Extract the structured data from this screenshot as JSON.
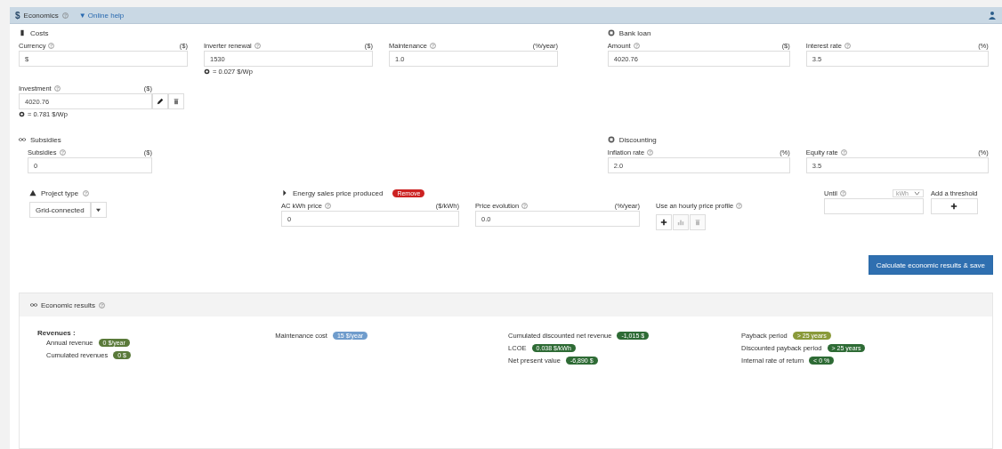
{
  "header": {
    "icon": "$",
    "title": "Economics",
    "help_link": "▼ Online help"
  },
  "costs": {
    "title": "Costs",
    "fields": [
      {
        "label": "Currency",
        "unit": "($)",
        "value": "$"
      },
      {
        "label": "Inverter renewal",
        "unit": "($)",
        "value": "1530",
        "note": "= 0.027 $/Wp"
      },
      {
        "label": "Maintenance",
        "unit": "(%/year)",
        "value": "1.0"
      }
    ],
    "investment": {
      "label": "Investment",
      "unit": "($)",
      "value": "4020.76",
      "note": "= 0.781 $/Wp"
    }
  },
  "bank_loan": {
    "title": "Bank loan",
    "fields": [
      {
        "label": "Amount",
        "unit": "($)",
        "value": "4020.76"
      },
      {
        "label": "Interest rate",
        "unit": "(%)",
        "value": "3.5"
      }
    ]
  },
  "subsidies": {
    "title": "Subsidies",
    "field": {
      "label": "Subsidies",
      "unit": "($)",
      "value": "0"
    }
  },
  "discounting": {
    "title": "Discounting",
    "fields": [
      {
        "label": "Inflation rate",
        "unit": "(%)",
        "value": "2.0"
      },
      {
        "label": "Equity rate",
        "unit": "(%)",
        "value": "3.5"
      }
    ]
  },
  "project_type": {
    "title": "Project type",
    "value": "Grid-connected"
  },
  "energy_sales": {
    "title": "Energy sales price produced",
    "badge": "Remove",
    "price": {
      "label": "AC kWh price",
      "unit": "($/kWh)",
      "value": "0"
    },
    "evolution": {
      "label": "Price evolution",
      "unit": "(%/year)",
      "value": "0.0"
    },
    "hourly_label": "Use an hourly price profile",
    "until": {
      "label": "Until",
      "unit": "kWh"
    },
    "threshold_label": "Add a threshold"
  },
  "calculate_button": "Calculate economic results & save",
  "results": {
    "title": "Economic results",
    "revenues_title": "Revenues :",
    "columns": [
      [
        {
          "label": "Annual revenue",
          "value": "0 $/year",
          "color": "#5a7a3a"
        },
        {
          "label": "Cumulated revenues",
          "value": "0 $",
          "color": "#5a7a3a"
        }
      ],
      [
        {
          "label": "Maintenance cost",
          "value": "15 $/year",
          "color": "#6f9ccc"
        }
      ],
      [
        {
          "label": "Cumulated discounted net revenue",
          "value": "-1,015 $",
          "color": "#2e6b35"
        },
        {
          "label": "LCOE",
          "value": "0.038 $/kWh",
          "color": "#2e6b35"
        },
        {
          "label": "Net present value",
          "value": "-6,890 $",
          "color": "#2e6b35"
        }
      ],
      [
        {
          "label": "Payback period",
          "value": "> 25 years",
          "color": "#8a9a3a"
        },
        {
          "label": "Discounted payback period",
          "value": "> 25 years",
          "color": "#2e6b35"
        },
        {
          "label": "Internal rate of return",
          "value": "< 0 %",
          "color": "#2e6b35"
        }
      ]
    ]
  }
}
